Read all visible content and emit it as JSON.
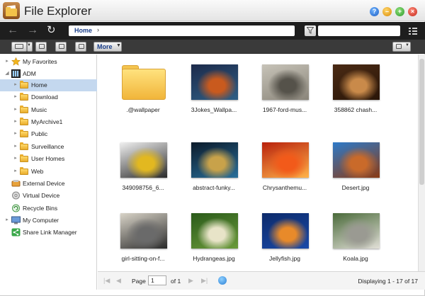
{
  "window": {
    "title": "File Explorer",
    "help_label": "?",
    "min_label": "–",
    "max_label": "+",
    "close_label": "×"
  },
  "nav": {
    "back_icon": "arrow-left-icon",
    "forward_icon": "arrow-right-icon",
    "refresh_icon": "refresh-icon",
    "path": "Home",
    "path_separator": "›",
    "search_placeholder": ""
  },
  "toolbar": {
    "more_label": "More"
  },
  "sidebar": {
    "items": [
      {
        "label": "My Favorites",
        "icon": "star-icon",
        "toggle": "▸",
        "level": 0
      },
      {
        "label": "ADM",
        "icon": "nas-icon",
        "toggle": "◢",
        "level": 0
      },
      {
        "label": "Home",
        "icon": "folder-icon",
        "toggle": "▸",
        "level": 1,
        "selected": true
      },
      {
        "label": "Download",
        "icon": "folder-icon",
        "toggle": "▸",
        "level": 1
      },
      {
        "label": "Music",
        "icon": "folder-icon",
        "toggle": "▸",
        "level": 1
      },
      {
        "label": "MyArchive1",
        "icon": "folder-icon",
        "toggle": "▸",
        "level": 1
      },
      {
        "label": "Public",
        "icon": "folder-icon",
        "toggle": "▸",
        "level": 1
      },
      {
        "label": "Surveillance",
        "icon": "folder-icon",
        "toggle": "▸",
        "level": 1
      },
      {
        "label": "User Homes",
        "icon": "folder-icon",
        "toggle": "▸",
        "level": 1
      },
      {
        "label": "Web",
        "icon": "folder-icon",
        "toggle": "▸",
        "level": 1
      },
      {
        "label": "External Device",
        "icon": "usb-drive-icon",
        "toggle": "",
        "level": 0
      },
      {
        "label": "Virtual Device",
        "icon": "disc-icon",
        "toggle": "",
        "level": 0
      },
      {
        "label": "Recycle Bins",
        "icon": "recycle-bin-icon",
        "toggle": "",
        "level": 0
      },
      {
        "label": "My Computer",
        "icon": "computer-icon",
        "toggle": "▸",
        "level": 0
      },
      {
        "label": "Share Link Manager",
        "icon": "share-icon",
        "toggle": "",
        "level": 0
      }
    ]
  },
  "files": [
    {
      "name": ".@wallpaper",
      "kind": "folder"
    },
    {
      "name": "3Jokes_Wallpa...",
      "kind": "image",
      "palette": [
        "#1c2a4a",
        "#c95a1e",
        "#2f5f86"
      ]
    },
    {
      "name": "1967-ford-mus...",
      "kind": "image",
      "palette": [
        "#c7c3b8",
        "#55524a",
        "#8a857a"
      ]
    },
    {
      "name": "358862 chash...",
      "kind": "image",
      "palette": [
        "#4a2a14",
        "#c98a4a",
        "#2a1608"
      ]
    },
    {
      "name": "349098756_6...",
      "kind": "image",
      "palette": [
        "#f0f0f0",
        "#e2b820",
        "#2a2a2a"
      ]
    },
    {
      "name": "abstract-funky...",
      "kind": "image",
      "palette": [
        "#0b1a2a",
        "#c8a24a",
        "#2a6f9a"
      ]
    },
    {
      "name": "Chrysanthemu...",
      "kind": "image",
      "palette": [
        "#b8210c",
        "#f25a1a",
        "#ffb34a"
      ]
    },
    {
      "name": "Desert.jpg",
      "kind": "image",
      "palette": [
        "#2d7ac9",
        "#c96a2a",
        "#8a3a14"
      ]
    },
    {
      "name": "girl-sitting-on-f...",
      "kind": "image",
      "palette": [
        "#d9d4c8",
        "#6a6a6a",
        "#2a2a2a"
      ]
    },
    {
      "name": "Hydrangeas.jpg",
      "kind": "image",
      "palette": [
        "#2a5a1a",
        "#e8e4c8",
        "#6a9a3a"
      ]
    },
    {
      "name": "Jellyfish.jpg",
      "kind": "image",
      "palette": [
        "#0c2a6a",
        "#e88a2a",
        "#1a4aa8"
      ]
    },
    {
      "name": "Koala.jpg",
      "kind": "image",
      "palette": [
        "#4a6a3a",
        "#9a9a92",
        "#e2e0d8"
      ]
    }
  ],
  "pager": {
    "page_label": "Page",
    "page_value": "1",
    "of_label": "of 1",
    "display_count": "Displaying 1 - 17 of 17"
  },
  "colors": {
    "nav_bg": "#1e1e1e",
    "toolbar_bg": "#3a3a3a",
    "selected_bg": "#c4d8ef",
    "path_text": "#1b3f8a"
  }
}
